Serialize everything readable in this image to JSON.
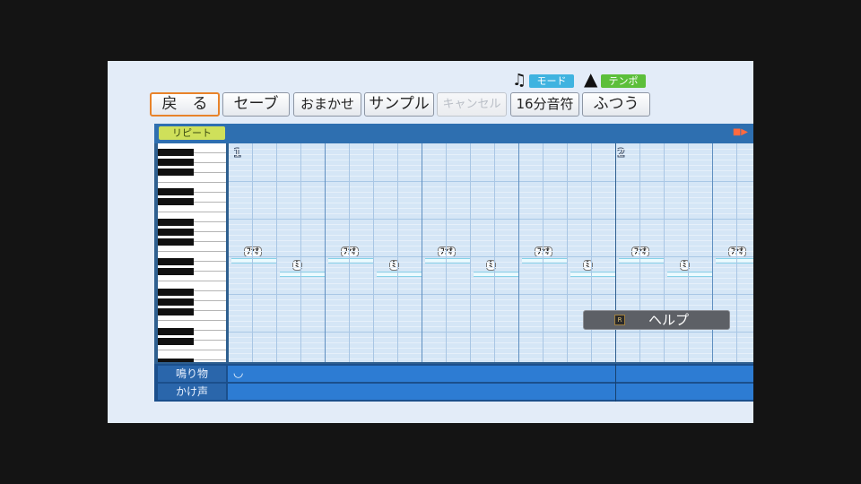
{
  "toolbar": {
    "back_label": "戻　る",
    "save_label": "セーブ",
    "auto_label": "おまかせ",
    "sample_label": "サンプル",
    "cancel_label": "キャンセル",
    "mode_tag": "モード",
    "tempo_tag": "テンポ",
    "mode_value": "16分音符",
    "tempo_value": "ふつう"
  },
  "editor": {
    "repeat_label": "リピート",
    "measures": [
      "1",
      "2"
    ],
    "note_labels": {
      "high": "ﾌｧｵ",
      "low": "ﾐ"
    },
    "tracks": {
      "sound": "鳴り物",
      "voice": "かけ声"
    }
  },
  "help": {
    "label": "ヘルプ",
    "button_glyph": "R"
  },
  "icons": [
    "music-note-icon",
    "metronome-icon",
    "drum-icon",
    "play-marker-icon"
  ],
  "colors": {
    "accent_orange": "#e8832a",
    "mode_tag": "#3fb3e0",
    "tempo_tag": "#5cbf3a",
    "repeat_tag": "#cfe05a",
    "grid_bg": "#d5e6f6",
    "track_blue": "#2d7cd3"
  }
}
